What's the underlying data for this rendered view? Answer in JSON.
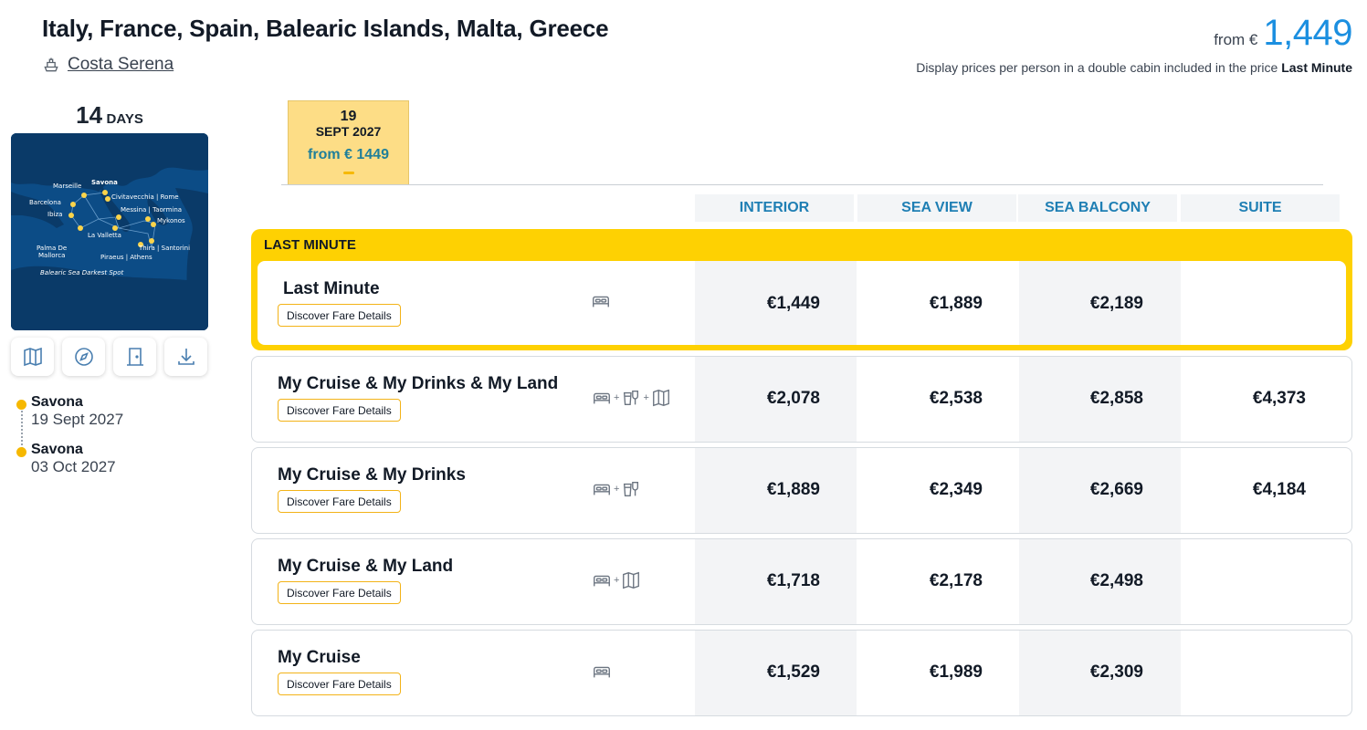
{
  "header": {
    "title": "Italy, France, Spain, Balearic Islands, Malta, Greece",
    "ship_name": "Costa Serena",
    "price_from_label": "from €",
    "price_from_value": "1,449",
    "price_note": "Display prices per person in a double cabin included in the price",
    "price_note_fare": "Last Minute"
  },
  "sidebar": {
    "days_number": "14",
    "days_label": "DAYS",
    "map_labels": {
      "savona": "Savona",
      "marseille": "Marseille",
      "civitavecchia": "Civitavecchia | Rome",
      "barcelona": "Barcelona",
      "messina": "Messina | Taormina",
      "ibiza": "Ibiza",
      "mykonos": "Mykonos",
      "valletta": "La Valletta",
      "palma1": "Palma De",
      "palma2": "Mallorca",
      "thira": "Thira | Santorini",
      "piraeus": "Piraeus | Athens",
      "balearic": "Balearic Sea Darkest Spot"
    },
    "itinerary": [
      {
        "port": "Savona",
        "date": "19 Sept 2027"
      },
      {
        "port": "Savona",
        "date": "03 Oct 2027"
      }
    ]
  },
  "date_tab": {
    "day": "19",
    "month": "SEPT 2027",
    "from": "from € 1449"
  },
  "columns": [
    "INTERIOR",
    "SEA VIEW",
    "SEA BALCONY",
    "SUITE"
  ],
  "last_minute_label": "LAST MINUTE",
  "discover_label": "Discover Fare Details",
  "fares": [
    {
      "name": "Last Minute",
      "icons": [
        "bed-icon"
      ],
      "prices": [
        "€1,449",
        "€1,889",
        "€2,189",
        ""
      ]
    },
    {
      "name": "My Cruise & My Drinks & My Land",
      "icons": [
        "bed-icon",
        "drinks-icon",
        "map-icon"
      ],
      "prices": [
        "€2,078",
        "€2,538",
        "€2,858",
        "€4,373"
      ]
    },
    {
      "name": "My Cruise & My Drinks",
      "icons": [
        "bed-icon",
        "drinks-icon"
      ],
      "prices": [
        "€1,889",
        "€2,349",
        "€2,669",
        "€4,184"
      ]
    },
    {
      "name": "My Cruise & My Land",
      "icons": [
        "bed-icon",
        "map-icon"
      ],
      "prices": [
        "€1,718",
        "€2,178",
        "€2,498",
        ""
      ]
    },
    {
      "name": "My Cruise",
      "icons": [
        "bed-icon"
      ],
      "prices": [
        "€1,529",
        "€1,989",
        "€2,309",
        ""
      ]
    }
  ],
  "colors": {
    "accent_blue": "#1b8fe0",
    "header_teal": "#1f7fb4",
    "last_minute_yellow": "#fed102",
    "date_tab_yellow": "#fddd86",
    "button_border": "#f3b318"
  }
}
